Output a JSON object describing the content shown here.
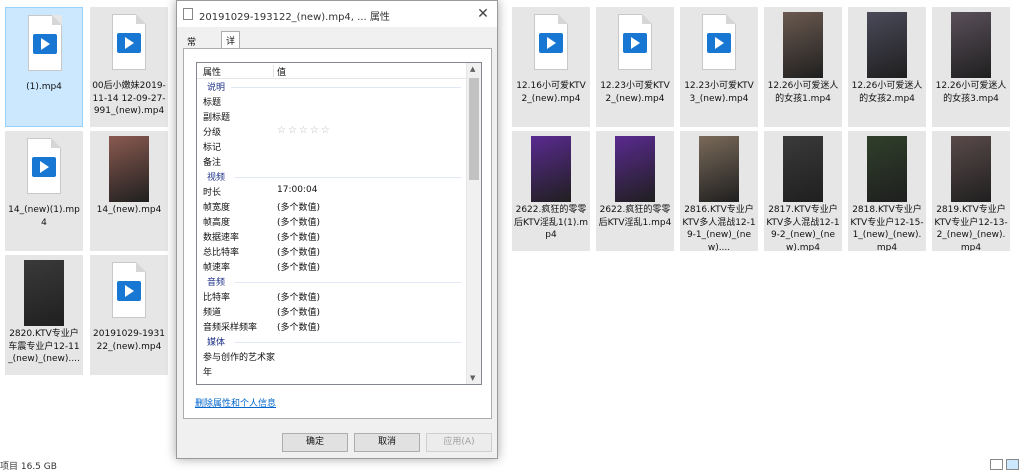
{
  "files": [
    {
      "label": "(1).mp4",
      "type": "doc",
      "selected": true
    },
    {
      "label": "00后小嫩妹2019-11-14 12-09-27-991_(new).mp4",
      "type": "doc"
    },
    {
      "label": "12.16小可爱KTV2_(new).mp4",
      "type": "doc"
    },
    {
      "label": "12.23小可爱KTV2_(new).mp4",
      "type": "doc"
    },
    {
      "label": "12.23小可爱KTV3_(new).mp4",
      "type": "doc"
    },
    {
      "label": "12.26小可爱迷人的女孩1.mp4",
      "type": "video",
      "color": "#6b5a50"
    },
    {
      "label": "12.26小可爱迷人的女孩2.mp4",
      "type": "video",
      "color": "#4a4a5a"
    },
    {
      "label": "12.26小可爱迷人的女孩3.mp4",
      "type": "video",
      "color": "#5a505a"
    },
    {
      "label": "14_(new)(1).mp4",
      "type": "doc"
    },
    {
      "label": "14_(new).mp4",
      "type": "video",
      "color": "#8a5a50"
    },
    {
      "label": "2622.疯狂的零零后KTV淫乱1(1).mp4",
      "type": "video",
      "color": "#5a2a90"
    },
    {
      "label": "2622.疯狂的零零后KTV淫乱1.mp4",
      "type": "video",
      "color": "#5a2a90"
    },
    {
      "label": "2816.KTV专业户KTV多人混战12-19-1_(new)_(new)....",
      "type": "video",
      "color": "#7a6a5a"
    },
    {
      "label": "2817.KTV专业户KTV多人混战12-19-2_(new)_(new).mp4",
      "type": "video",
      "color": "#3a3a3a"
    },
    {
      "label": "2818.KTV专业户KTV专业户12-15-1_(new)_(new).mp4",
      "type": "video",
      "color": "#2f3f2a"
    },
    {
      "label": "2819.KTV专业户KTV专业户12-13-2_(new)_(new).mp4",
      "type": "video",
      "color": "#5a4a4a"
    },
    {
      "label": "2820.KTV专业户车震专业户12-11_(new)_(new)....",
      "type": "video",
      "color": "#3a3a3a"
    },
    {
      "label": "20191029-193122_(new).mp4",
      "type": "doc"
    }
  ],
  "dialog": {
    "title": "20191029-193122_(new).mp4, ... 属性",
    "tabs": [
      "常规",
      "详细信息"
    ],
    "header": {
      "property": "属性",
      "value": "值"
    },
    "rows": [
      {
        "k": "说明",
        "v": "",
        "section": true
      },
      {
        "k": "标题",
        "v": ""
      },
      {
        "k": "副标题",
        "v": ""
      },
      {
        "k": "分级",
        "v": "☆☆☆☆☆",
        "stars": true
      },
      {
        "k": "标记",
        "v": ""
      },
      {
        "k": "备注",
        "v": ""
      },
      {
        "k": "视频",
        "v": "",
        "section": true
      },
      {
        "k": "时长",
        "v": "17:00:04"
      },
      {
        "k": "帧宽度",
        "v": "(多个数值)"
      },
      {
        "k": "帧高度",
        "v": "(多个数值)"
      },
      {
        "k": "数据速率",
        "v": "(多个数值)"
      },
      {
        "k": "总比特率",
        "v": "(多个数值)"
      },
      {
        "k": "帧速率",
        "v": "(多个数值)"
      },
      {
        "k": "音频",
        "v": "",
        "section": true
      },
      {
        "k": "比特率",
        "v": "(多个数值)"
      },
      {
        "k": "频道",
        "v": "(多个数值)"
      },
      {
        "k": "音频采样频率",
        "v": "(多个数值)"
      },
      {
        "k": "媒体",
        "v": "",
        "section": true
      },
      {
        "k": "参与创作的艺术家",
        "v": ""
      },
      {
        "k": "年",
        "v": ""
      }
    ],
    "remove_link": "删除属性和个人信息",
    "buttons": {
      "ok": "确定",
      "cancel": "取消",
      "apply": "应用(A)"
    }
  },
  "status": {
    "text": "项目 16.5 GB"
  }
}
